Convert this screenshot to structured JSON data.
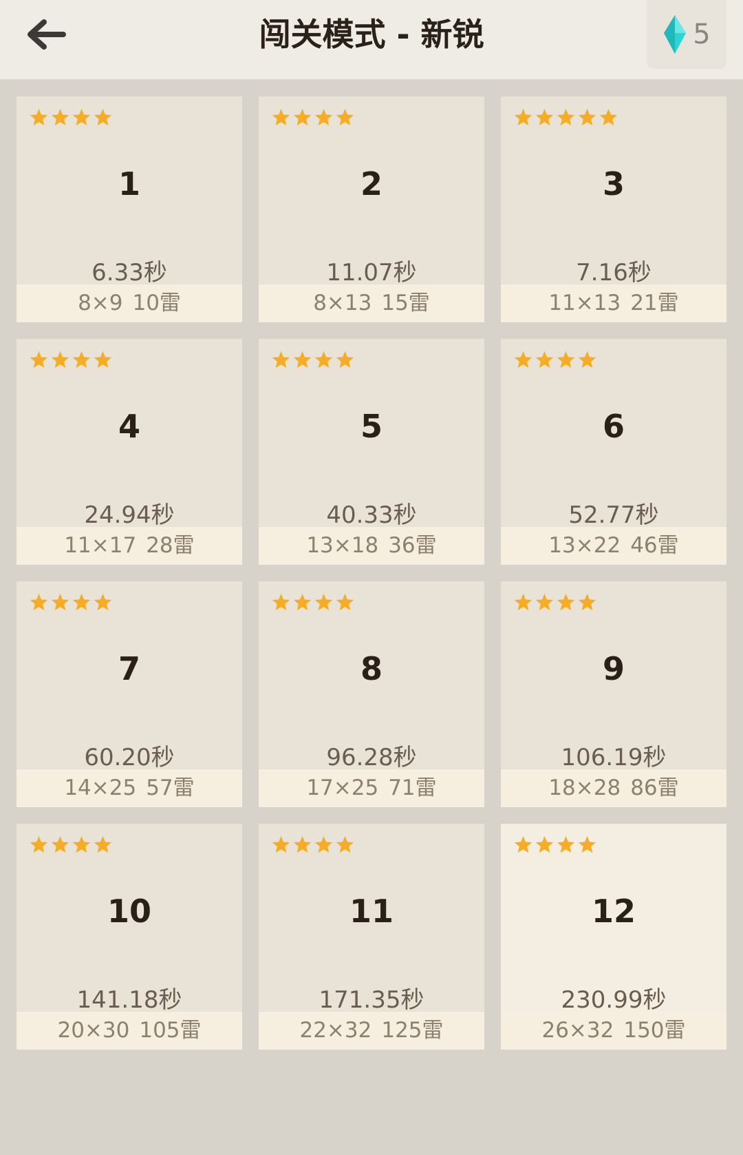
{
  "header": {
    "title": "闯关模式 - 新锐",
    "gem_count": "5"
  },
  "colors": {
    "star": "#f5ad28",
    "gem": "#2fd3d1",
    "background": "#d7d3cb",
    "card": "#e8e2d7"
  },
  "levels": [
    {
      "number": "1",
      "stars": 4,
      "time": "6.33秒",
      "size": "8×9",
      "mines": "10雷"
    },
    {
      "number": "2",
      "stars": 4,
      "time": "11.07秒",
      "size": "8×13",
      "mines": "15雷"
    },
    {
      "number": "3",
      "stars": 5,
      "time": "7.16秒",
      "size": "11×13",
      "mines": "21雷"
    },
    {
      "number": "4",
      "stars": 4,
      "time": "24.94秒",
      "size": "11×17",
      "mines": "28雷"
    },
    {
      "number": "5",
      "stars": 4,
      "time": "40.33秒",
      "size": "13×18",
      "mines": "36雷"
    },
    {
      "number": "6",
      "stars": 4,
      "time": "52.77秒",
      "size": "13×22",
      "mines": "46雷"
    },
    {
      "number": "7",
      "stars": 4,
      "time": "60.20秒",
      "size": "14×25",
      "mines": "57雷"
    },
    {
      "number": "8",
      "stars": 4,
      "time": "96.28秒",
      "size": "17×25",
      "mines": "71雷"
    },
    {
      "number": "9",
      "stars": 4,
      "time": "106.19秒",
      "size": "18×28",
      "mines": "86雷"
    },
    {
      "number": "10",
      "stars": 4,
      "time": "141.18秒",
      "size": "20×30",
      "mines": "105雷"
    },
    {
      "number": "11",
      "stars": 4,
      "time": "171.35秒",
      "size": "22×32",
      "mines": "125雷"
    },
    {
      "number": "12",
      "stars": 4,
      "time": "230.99秒",
      "size": "26×32",
      "mines": "150雷"
    }
  ]
}
